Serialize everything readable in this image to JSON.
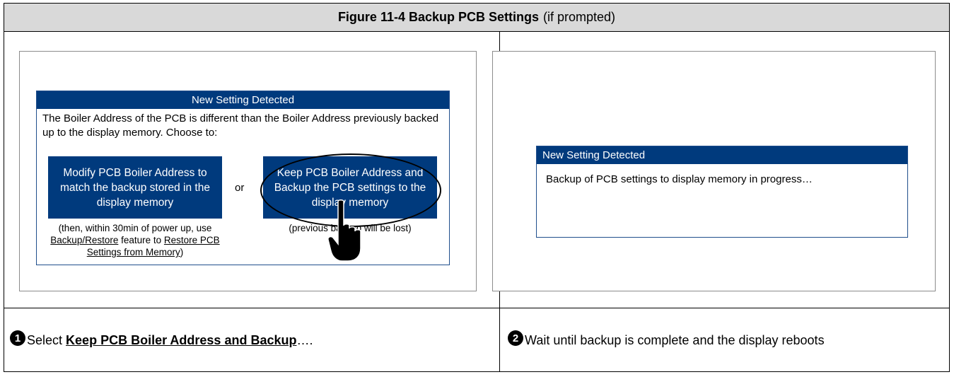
{
  "figure": {
    "title_bold": "Figure 11-4 Backup PCB Settings",
    "title_suffix": "(if prompted)"
  },
  "left_screen": {
    "dialog_title": "New Setting Detected",
    "message": "The Boiler Address of the PCB is different than the Boiler Address previously backed up to the display memory.  Choose to:",
    "option_modify_label": "Modify PCB Boiler Address to match the backup stored in the display memory",
    "or_text": "or",
    "option_keep_label": "Keep PCB Boiler Address and Backup the PCB settings to the display memory",
    "modify_note_pre": "(then, within 30min of power up, use ",
    "modify_note_link1": "Backup/Restore",
    "modify_note_mid": " feature to ",
    "modify_note_link2": "Restore PCB Settings from Memory",
    "modify_note_post": ")",
    "keep_note": "(previous backup will be lost)"
  },
  "right_screen": {
    "dialog_title": "New Setting Detected",
    "progress_message": "Backup of PCB settings to display memory in progress…"
  },
  "steps": [
    {
      "number": "1",
      "text_pre": "Select ",
      "text_bold": "Keep PCB Boiler Address and Backup",
      "text_post": "…."
    },
    {
      "number": "2",
      "text": "Wait until backup is complete and the display reboots"
    }
  ],
  "icons": {
    "pointer": "pointing-hand-icon"
  },
  "colors": {
    "dialog_blue": "#003a7d",
    "title_bar_gray": "#d9d9d9"
  }
}
